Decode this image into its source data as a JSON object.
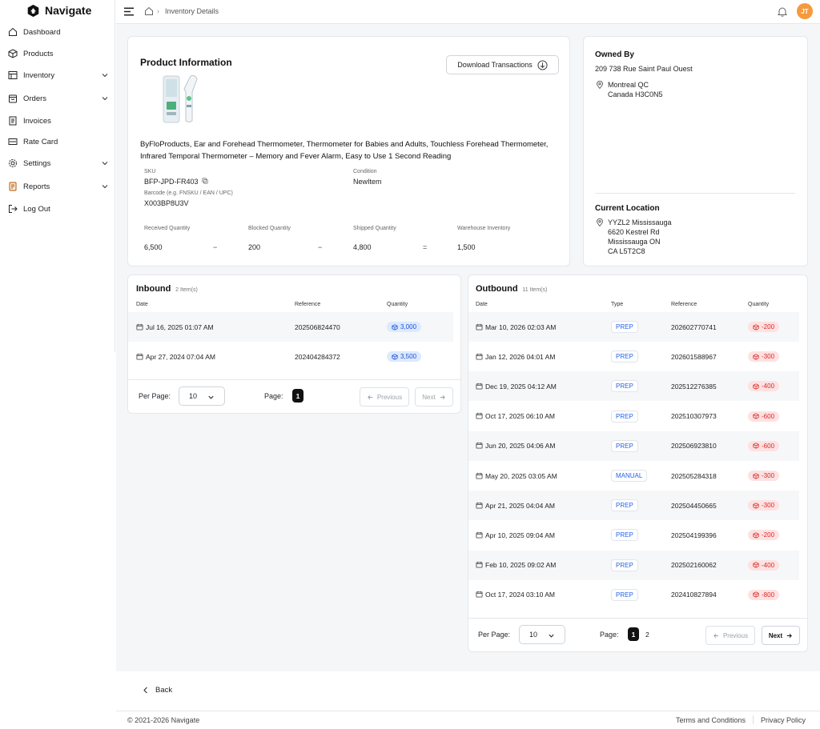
{
  "app": {
    "name": "Navigate"
  },
  "sidebar": {
    "items": [
      {
        "label": "Dashboard",
        "icon": "home-icon"
      },
      {
        "label": "Products",
        "icon": "box-icon"
      },
      {
        "label": "Inventory",
        "icon": "inventory-icon",
        "expandable": true
      },
      {
        "label": "Orders",
        "icon": "bag-icon",
        "expandable": true
      },
      {
        "label": "Invoices",
        "icon": "invoice-icon"
      },
      {
        "label": "Rate Card",
        "icon": "rate-card-icon"
      },
      {
        "label": "Settings",
        "icon": "gear-icon",
        "expandable": true
      },
      {
        "label": "Reports",
        "icon": "report-icon",
        "expandable": true
      },
      {
        "label": "Log Out",
        "icon": "logout-icon"
      }
    ]
  },
  "header": {
    "breadcrumb": "Inventory Details",
    "avatar_initials": "JT"
  },
  "product": {
    "section_title": "Product Information",
    "download_label": "Download Transactions",
    "title": "ByFloProducts, Ear and Forehead Thermometer, Thermometer for Babies and Adults, Touchless Forehead Thermometer, Infrared Temporal Thermometer – Memory and Fever Alarm, Easy to Use 1 Second Reading",
    "sku_label": "SKU",
    "sku": "BFP-JPD-FR403",
    "condition_label": "Condition",
    "condition": "NewItem",
    "barcode_label": "Barcode (e.g. FNSKU / EAN / UPC)",
    "barcode": "X003BP8U3V",
    "quantities": {
      "received_label": "Received Quantity",
      "received": "6,500",
      "blocked_label": "Blocked Quantity",
      "blocked": "200",
      "shipped_label": "Shipped Quantity",
      "shipped": "4,800",
      "warehouse_label": "Warehouse Inventory",
      "warehouse": "1,500",
      "op_minus": "−",
      "op_equals": "="
    }
  },
  "owner": {
    "title": "Owned By",
    "line1": "209 738 Rue Saint Paul Ouest",
    "city": "Montreal QC",
    "country": "Canada H3C0N5",
    "location_title": "Current Location",
    "loc1": "YYZL2 Mississauga",
    "loc2": "6620 Kestrel Rd",
    "loc3": "Mississauga ON",
    "loc4": "CA L5T2C8"
  },
  "inbound": {
    "title": "Inbound",
    "count": "2 Item(s)",
    "columns": [
      "Date",
      "Reference",
      "Quantity"
    ],
    "rows": [
      {
        "date": "Jul 16, 2025 01:07 AM",
        "reference": "202506824470",
        "quantity": "3,000"
      },
      {
        "date": "Apr 27, 2024 07:04 AM",
        "reference": "202404284372",
        "quantity": "3,500"
      }
    ],
    "per_page_label": "Per Page:",
    "per_page": "10",
    "page_label": "Page:",
    "pages": [
      "1"
    ],
    "prev": "Previous",
    "next": "Next"
  },
  "outbound": {
    "title": "Outbound",
    "count": "11 Item(s)",
    "columns": [
      "Date",
      "Type",
      "Reference",
      "Quantity"
    ],
    "rows": [
      {
        "date": "Mar 10, 2026 02:03 AM",
        "type": "PREP",
        "reference": "202602770741",
        "quantity": "-200"
      },
      {
        "date": "Jan 12, 2026 04:01 AM",
        "type": "PREP",
        "reference": "202601588967",
        "quantity": "-300"
      },
      {
        "date": "Dec 19, 2025 04:12 AM",
        "type": "PREP",
        "reference": "202512276385",
        "quantity": "-400"
      },
      {
        "date": "Oct 17, 2025 06:10 AM",
        "type": "PREP",
        "reference": "202510307973",
        "quantity": "-600"
      },
      {
        "date": "Jun 20, 2025 04:06 AM",
        "type": "PREP",
        "reference": "202506923810",
        "quantity": "-600"
      },
      {
        "date": "May 20, 2025 03:05 AM",
        "type": "MANUAL",
        "reference": "202505284318",
        "quantity": "-300"
      },
      {
        "date": "Apr 21, 2025 04:04 AM",
        "type": "PREP",
        "reference": "202504450665",
        "quantity": "-300"
      },
      {
        "date": "Apr 10, 2025 09:04 AM",
        "type": "PREP",
        "reference": "202504199396",
        "quantity": "-200"
      },
      {
        "date": "Feb 10, 2025 09:02 AM",
        "type": "PREP",
        "reference": "202502160062",
        "quantity": "-400"
      },
      {
        "date": "Oct 17, 2024 03:10 AM",
        "type": "PREP",
        "reference": "202410827894",
        "quantity": "-800"
      }
    ],
    "per_page_label": "Per Page:",
    "per_page": "10",
    "page_label": "Page:",
    "pages": [
      "1",
      "2"
    ],
    "prev": "Previous",
    "next": "Next"
  },
  "back_label": "Back",
  "footer": {
    "copyright": "© 2021-2026 Navigate",
    "terms": "Terms and Conditions",
    "privacy": "Privacy Policy"
  }
}
